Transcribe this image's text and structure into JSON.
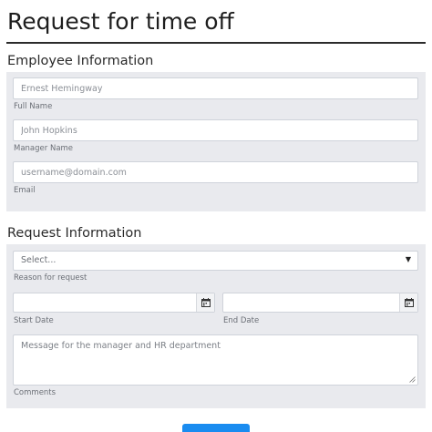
{
  "page": {
    "title": "Request for time off"
  },
  "employee": {
    "section_title": "Employee Information",
    "full_name": {
      "placeholder": "Ernest Hemingway",
      "label": "Full Name"
    },
    "manager_name": {
      "placeholder": "John Hopkins",
      "label": "Manager Name"
    },
    "email": {
      "placeholder": "username@domain.com",
      "label": "Email"
    }
  },
  "request": {
    "section_title": "Request Information",
    "reason": {
      "selected": "Select...",
      "label": "Reason for request"
    },
    "start_date": {
      "value": "",
      "label": "Start Date"
    },
    "end_date": {
      "value": "",
      "label": "End Date"
    },
    "comments": {
      "placeholder": "Message for the manager and HR department",
      "label": "Comments"
    }
  },
  "icons": {
    "calendar": "calendar-icon",
    "dropdown": "caret-down-icon",
    "resize": "resize-grip-icon"
  },
  "colors": {
    "panel_bg": "#e9eaee",
    "accent": "#1a8cf0"
  }
}
